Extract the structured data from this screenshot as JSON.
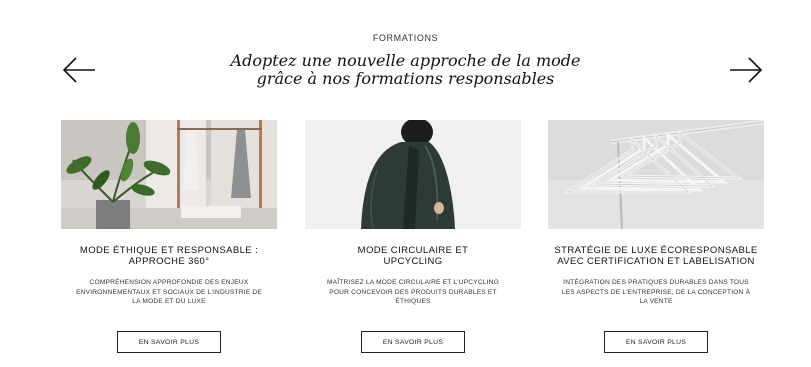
{
  "section": {
    "eyebrow": "FORMATIONS",
    "headline_line1": "Adoptez une nouvelle approche de la mode",
    "headline_line2": "grâce à nos formations responsables"
  },
  "navigation": {
    "prev_icon": "arrow-left-icon",
    "next_icon": "arrow-right-icon"
  },
  "cards": [
    {
      "title_line1": "MODE ÉTHIQUE ET RESPONSABLE :",
      "title_line2": "APPROCHE 360°",
      "desc_line1": "COMPRÉHENSION APPROFONDIE DES ENJEUX",
      "desc_line2": "ENVIRONNEMENTAUX ET SOCIAUX DE L'INDUSTRIE DE",
      "desc_line3": "LA MODE ET DU LUXE",
      "button_label": "EN SAVOIR PLUS"
    },
    {
      "title_line1": "MODE CIRCULAIRE ET",
      "title_line2": "UPCYCLING",
      "desc_line1": "MAÎTRISEZ LA MODE CIRCULAIRE ET L'UPCYCLING",
      "desc_line2": "POUR CONCEVOIR DES PRODUITS DURABLES ET",
      "desc_line3": "ÉTHIQUES",
      "button_label": "EN SAVOIR PLUS"
    },
    {
      "title_line1": "STRATÉGIE DE LUXE ÉCORESPONSABLE",
      "title_line2": "AVEC CERTIFICATION ET LABELISATION",
      "desc_line1": "INTÉGRATION DES PRATIQUES DURABLES DANS TOUS",
      "desc_line2": "LES ASPECTS DE L'ENTREPRISE, DE LA CONCEPTION À",
      "desc_line3": "LA VENTE",
      "button_label": "EN SAVOIR PLUS"
    }
  ],
  "colors": {
    "text": "#111111",
    "button_border": "#222222",
    "background": "#ffffff"
  }
}
